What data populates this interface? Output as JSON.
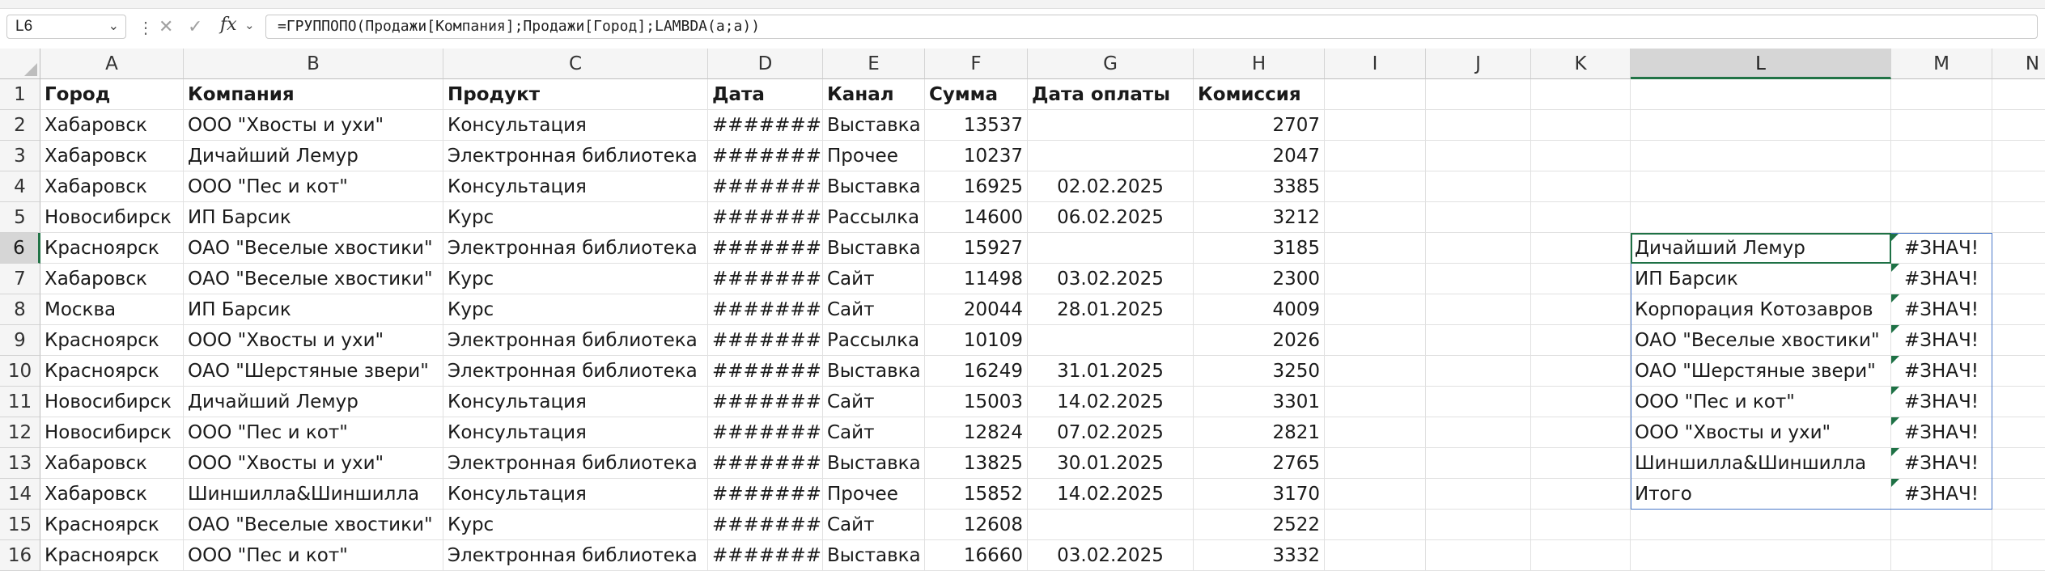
{
  "formula_bar": {
    "name_box": "L6",
    "formula": "=ГРУППОПО(Продажи[Компания];Продажи[Город];LAMBDA(a;a))"
  },
  "columns": [
    "A",
    "B",
    "C",
    "D",
    "E",
    "F",
    "G",
    "H",
    "I",
    "J",
    "K",
    "L",
    "M",
    "N"
  ],
  "selected_column": "L",
  "selected_row": "6",
  "rows": [
    "1",
    "2",
    "3",
    "4",
    "5",
    "6",
    "7",
    "8",
    "9",
    "10",
    "11",
    "12",
    "13",
    "14",
    "15",
    "16"
  ],
  "table": {
    "header": [
      "Город",
      "Компания",
      "Продукт",
      "Дата",
      "Канал",
      "Сумма",
      "Дата оплаты",
      "Комиссия"
    ],
    "data": [
      [
        "Хабаровск",
        "ООО \"Хвосты и ухи\"",
        "Консультация",
        "#########",
        "Выставка",
        "13537",
        "",
        "2707"
      ],
      [
        "Хабаровск",
        "Дичайший Лемур",
        "Электронная библиотека",
        "#########",
        "Прочее",
        "10237",
        "",
        "2047"
      ],
      [
        "Хабаровск",
        "ООО \"Пес и кот\"",
        "Консультация",
        "#########",
        "Выставка",
        "16925",
        "02.02.2025",
        "3385"
      ],
      [
        "Новосибирск",
        "ИП Барсик",
        "Курс",
        "#########",
        "Рассылка",
        "14600",
        "06.02.2025",
        "3212"
      ],
      [
        "Красноярск",
        "ОАО \"Веселые хвостики\"",
        "Электронная библиотека",
        "#########",
        "Выставка",
        "15927",
        "",
        "3185"
      ],
      [
        "Хабаровск",
        "ОАО \"Веселые хвостики\"",
        "Курс",
        "#########",
        "Сайт",
        "11498",
        "03.02.2025",
        "2300"
      ],
      [
        "Москва",
        "ИП Барсик",
        "Курс",
        "#########",
        "Сайт",
        "20044",
        "28.01.2025",
        "4009"
      ],
      [
        "Красноярск",
        "ООО \"Хвосты и ухи\"",
        "Электронная библиотека",
        "#########",
        "Рассылка",
        "10109",
        "",
        "2026"
      ],
      [
        "Красноярск",
        "ОАО \"Шерстяные звери\"",
        "Электронная библиотека",
        "#########",
        "Выставка",
        "16249",
        "31.01.2025",
        "3250"
      ],
      [
        "Новосибирск",
        "Дичайший Лемур",
        "Консультация",
        "#########",
        "Сайт",
        "15003",
        "14.02.2025",
        "3301"
      ],
      [
        "Новосибирск",
        "ООО \"Пес и кот\"",
        "Консультация",
        "#########",
        "Сайт",
        "12824",
        "07.02.2025",
        "2821"
      ],
      [
        "Хабаровск",
        "ООО \"Хвосты и ухи\"",
        "Электронная библиотека",
        "#########",
        "Выставка",
        "13825",
        "30.01.2025",
        "2765"
      ],
      [
        "Хабаровск",
        "Шиншилла&Шиншилла",
        "Консультация",
        "#########",
        "Прочее",
        "15852",
        "14.02.2025",
        "3170"
      ],
      [
        "Красноярск",
        "ОАО \"Веселые хвостики\"",
        "Курс",
        "#########",
        "Сайт",
        "12608",
        "",
        "2522"
      ],
      [
        "Красноярск",
        "ООО \"Пес и кот\"",
        "Электронная библиотека",
        "#########",
        "Выставка",
        "16660",
        "03.02.2025",
        "3332"
      ]
    ]
  },
  "spill": [
    [
      "Дичайший Лемур",
      "#ЗНАЧ!"
    ],
    [
      "ИП Барсик",
      "#ЗНАЧ!"
    ],
    [
      "Корпорация Котозавров",
      "#ЗНАЧ!"
    ],
    [
      "ОАО \"Веселые хвостики\"",
      "#ЗНАЧ!"
    ],
    [
      "ОАО \"Шерстяные звери\"",
      "#ЗНАЧ!"
    ],
    [
      "ООО \"Пес и кот\"",
      "#ЗНАЧ!"
    ],
    [
      "ООО \"Хвосты и ухи\"",
      "#ЗНАЧ!"
    ],
    [
      "Шиншилла&Шиншилла",
      "#ЗНАЧ!"
    ],
    [
      "Итого",
      "#ЗНАЧ!"
    ]
  ],
  "colors": {
    "accent": "#1e7145",
    "spill_border": "#4a78c8",
    "header_bg": "#f5f5f5",
    "header_selected_bg": "#d6d6d6"
  }
}
